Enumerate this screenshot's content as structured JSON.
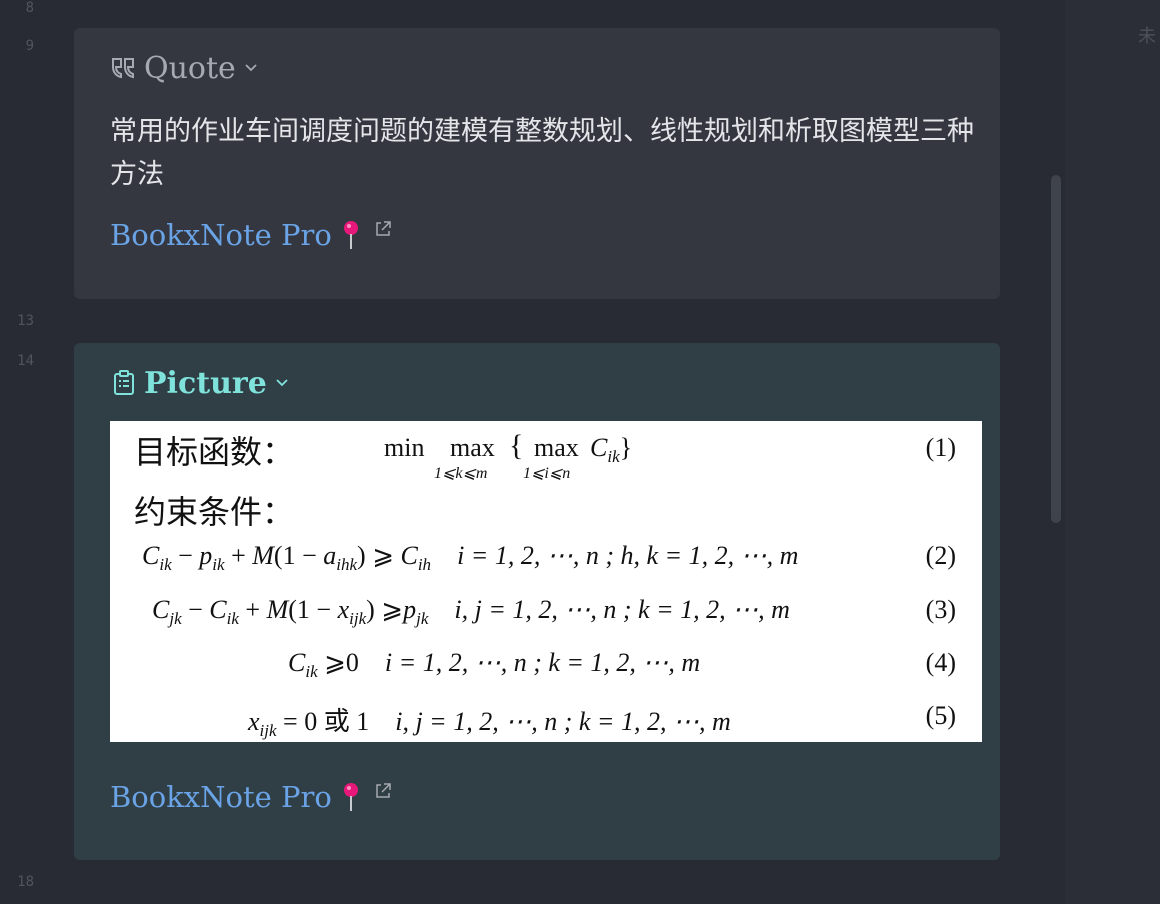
{
  "gutter": [
    "8",
    "9",
    "13",
    "14",
    "18"
  ],
  "right_panel": {
    "truncated_text": "未"
  },
  "quote_callout": {
    "icon": "quote-icon",
    "title": "Quote",
    "text": "常用的作业车间调度问题的建模有整数规划、线性规划和析取图模型三种方法",
    "source_label": "BookxNote Pro"
  },
  "picture_callout": {
    "icon": "clipboard-icon",
    "title": "Picture",
    "source_label": "BookxNote Pro",
    "formulas": {
      "objective_label": "目标函数：",
      "objective": {
        "min": "min",
        "max": "max",
        "under_k": "1⩽k⩽m",
        "under_i": "1⩽i⩽n",
        "c": "C",
        "sub": "ik",
        "num": "(1)"
      },
      "constraint_label": "约束条件：",
      "eq2": {
        "lhs": "C",
        "text": "i = 1, 2, ⋯, n ; h, k = 1, 2, ⋯, m",
        "num": "(2)"
      },
      "eq3": {
        "text": "i, j = 1, 2, ⋯, n ; k = 1, 2, ⋯, m",
        "num": "(3)"
      },
      "eq4": {
        "rel": "⩾0",
        "text": "i = 1, 2, ⋯, n ; k = 1, 2, ⋯, m",
        "num": "(4)"
      },
      "eq5": {
        "rel": "= 0 或 1",
        "text": "i, j = 1, 2, ⋯, n ; k = 1, 2, ⋯, m",
        "num": "(5)"
      }
    }
  },
  "colors": {
    "accent_teal": "#7fe3dc",
    "link_blue": "#6aa3e6",
    "pin_magenta": "#e8187a"
  }
}
